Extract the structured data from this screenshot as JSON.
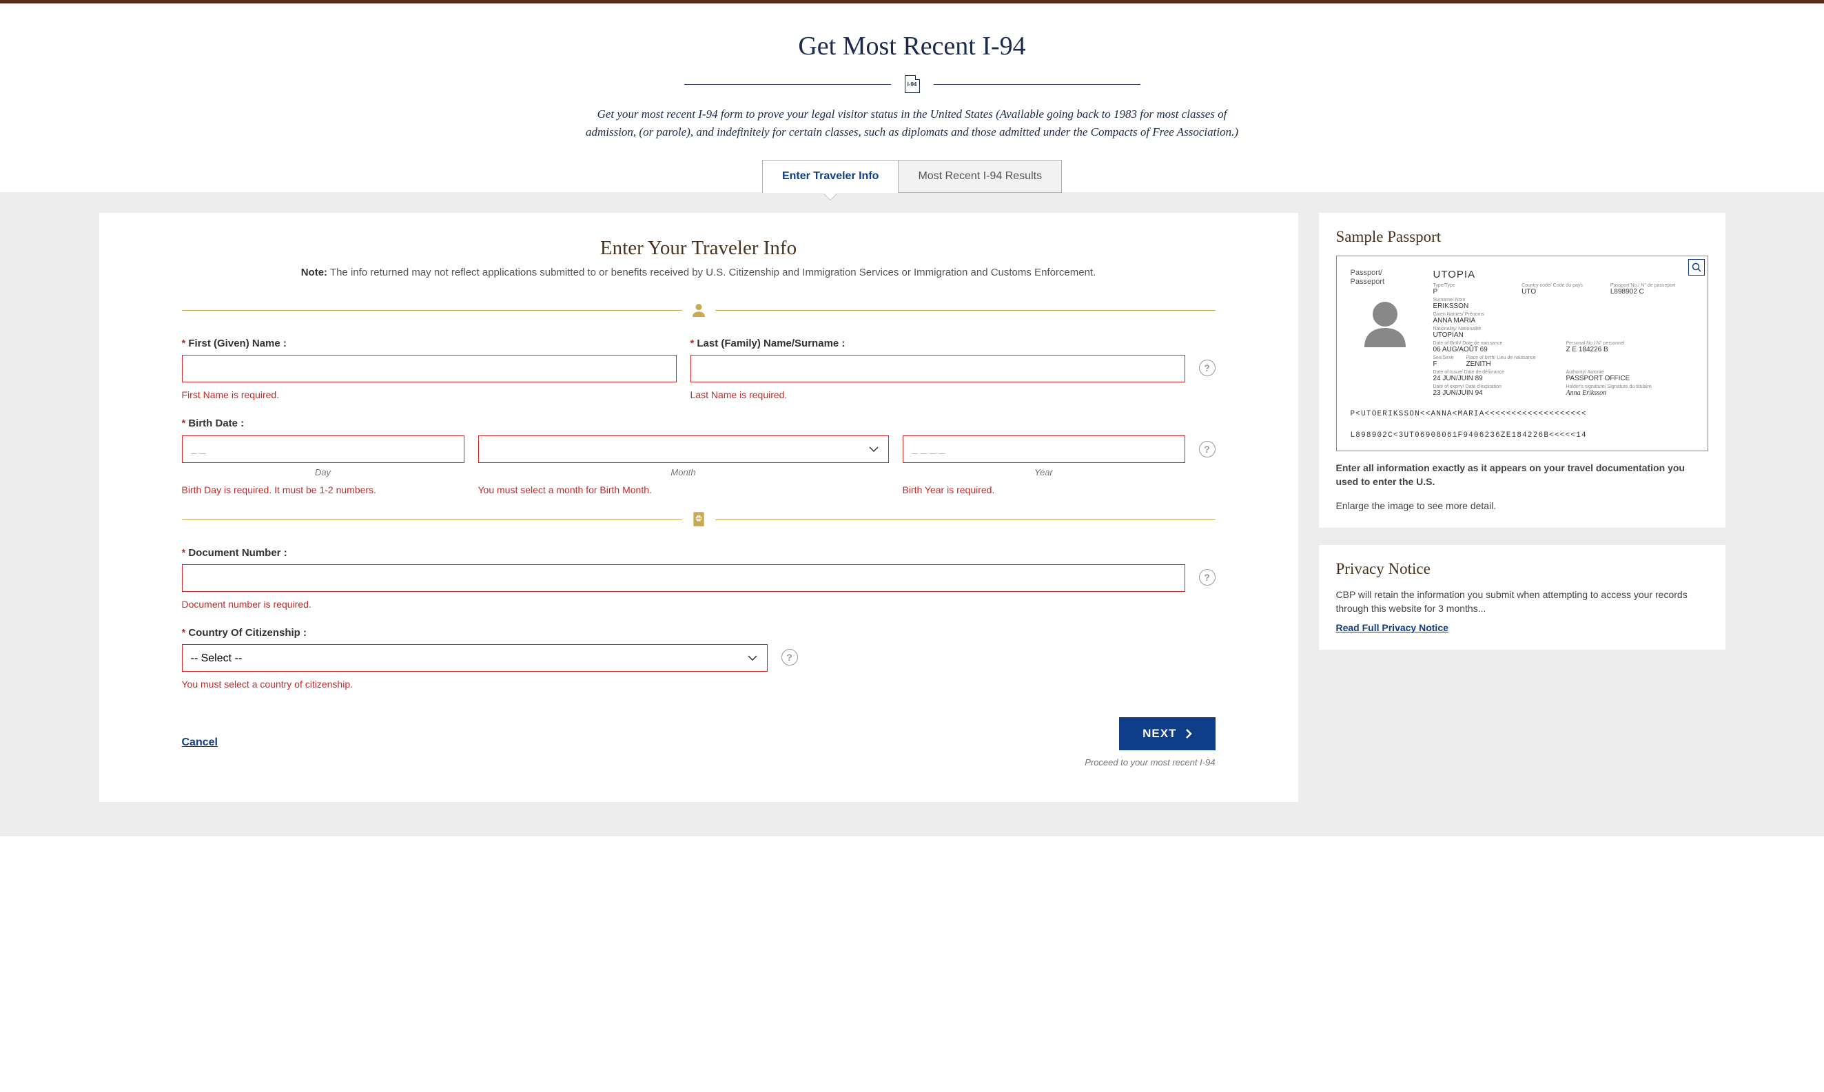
{
  "header": {
    "title": "Get Most Recent I-94",
    "doc_icon_text": "I-94",
    "subtitle": "Get your most recent I-94 form to prove your legal visitor status in the United States (Available going back to 1983 for most classes of admission, (or parole), and indefinitely for certain classes, such as diplomats and those admitted under the Compacts of Free Association.)",
    "tabs": {
      "active": "Enter Traveler Info",
      "inactive": "Most Recent I-94 Results"
    }
  },
  "form": {
    "title": "Enter Your Traveler Info",
    "note_label": "Note:",
    "note_text": " The info returned may not reflect applications submitted to or benefits received by U.S. Citizenship and Immigration Services or Immigration and Customs Enforcement.",
    "first_name": {
      "label": "First (Given) Name :",
      "error": "First Name is required."
    },
    "last_name": {
      "label": "Last (Family) Name/Surname :",
      "error": "Last Name is required."
    },
    "birth_date": {
      "label": "Birth Date :",
      "day_placeholder": "_ _",
      "day_sub": "Day",
      "day_error": "Birth Day is required. It must be 1-2 numbers.",
      "month_sub": "Month",
      "month_error": "You must select a month for Birth Month.",
      "year_placeholder": "_ _ _ _",
      "year_sub": "Year",
      "year_error": "Birth Year is required."
    },
    "document": {
      "label": "Document Number :",
      "error": "Document number is required."
    },
    "country": {
      "label": "Country Of Citizenship :",
      "placeholder": "-- Select --",
      "error": "You must select a country of citizenship."
    },
    "cancel": "Cancel",
    "next": "NEXT",
    "proceed": "Proceed to your most recent I-94"
  },
  "passport": {
    "title": "Sample Passport",
    "card_label": "Passport/\nPasseport",
    "country": "UTOPIA",
    "fields": {
      "type_label": "Type/Type",
      "type": "P",
      "code_label": "Country code/ Code du pays",
      "code": "UTO",
      "ppno_label": "Passport No./ N° de passeport",
      "ppno": "L898902 C",
      "surname_label": "Surname/ Nom",
      "surname": "ERIKSSON",
      "given_label": "Given Names/ Prénoms",
      "given": "ANNA MARIA",
      "nat_label": "Nationality/ Nationalité",
      "nat": "UTOPIAN",
      "dob_label": "Date of Birth/ Date de naissance",
      "dob": "06 AUG/AOÛT 69",
      "pno_label": "Personal No./ N° personnel",
      "pno": "Z E 184226 B",
      "sex_label": "Sex/Sexe",
      "sex": "F",
      "pob_label": "Place of birth/ Lieu de naissance",
      "pob": "ZENITH",
      "doi_label": "Date of Issue/ Date de délivrance",
      "doi": "24 JUN/JUIN 89",
      "auth_label": "Authority/ Autorité",
      "auth": "PASSPORT OFFICE",
      "doe_label": "Date of expiry/ Date d'expiration",
      "doe": "23 JUN/JUIN 94",
      "sig_label": "Holder's signature/ Signature du titulaire"
    },
    "mrz1": "P<UTOERIKSSON<<ANNA<MARIA<<<<<<<<<<<<<<<<<<<",
    "mrz2": "L898902C<3UT06908061F9406236ZE184226B<<<<<14",
    "instruction_bold": "Enter all information exactly as it appears on your travel documentation you used to enter the U.S.",
    "instruction": "Enlarge the image to see more detail."
  },
  "privacy": {
    "title": "Privacy Notice",
    "text": "CBP will retain the information you submit when attempting to access your records through this website for 3 months...",
    "link": "Read Full Privacy Notice"
  }
}
